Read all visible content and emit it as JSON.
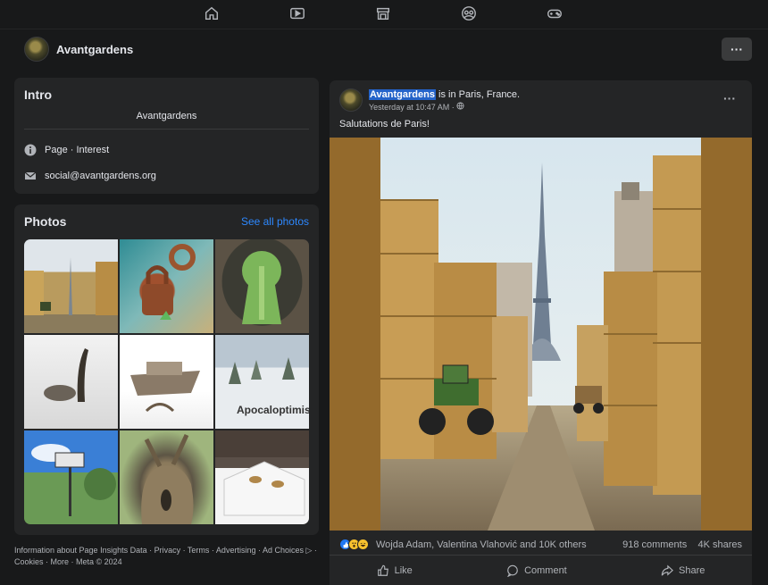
{
  "top_nav": {
    "icons": [
      "home-icon",
      "video-icon",
      "marketplace-icon",
      "groups-icon",
      "gaming-icon"
    ]
  },
  "page_header": {
    "page_name": "Avantgardens",
    "more_label": "···"
  },
  "intro": {
    "title": "Intro",
    "bio": "Avantgardens",
    "category": "Page · Interest",
    "email": "social@avantgardens.org"
  },
  "photos": {
    "title": "Photos",
    "see_all": "See all photos",
    "thumb_label": "Apocaloptimis"
  },
  "footer": {
    "text": "Information about Page Insights Data · Privacy · Terms · Advertising · Ad Choices ▷ · Cookies · More · Meta © 2024"
  },
  "post": {
    "author": "Avantgardens",
    "location_text": "is in",
    "location": "Paris, France.",
    "timestamp": "Yesterday at 10:47 AM ·",
    "caption": "Salutations de Paris!",
    "reactions_names": "Wojda Adam, Valentina Vlahović and 10K others",
    "comments": "918 comments",
    "shares": "4K shares",
    "actions": {
      "like": "Like",
      "comment": "Comment",
      "share": "Share"
    }
  },
  "colors": {
    "background": "#18191a",
    "card": "#242526",
    "accent": "#2d88ff",
    "highlight": "#2463c9"
  }
}
